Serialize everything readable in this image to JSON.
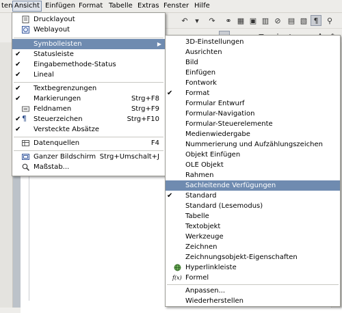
{
  "menubar": {
    "items": [
      "ten",
      "Ansicht",
      "Einfügen",
      "Format",
      "Tabelle",
      "Extras",
      "Fenster",
      "Hilfe"
    ]
  },
  "view_menu": {
    "items": [
      {
        "label": "Drucklayout",
        "checked": false,
        "icon": "print-layout-icon"
      },
      {
        "label": "Weblayout",
        "checked": true,
        "icon": "web-layout-icon"
      },
      {
        "label": "Symbolleisten",
        "submenu": true
      },
      {
        "label": "Statusleiste",
        "checked": true
      },
      {
        "label": "Eingabemethode-Status",
        "checked": true
      },
      {
        "label": "Lineal",
        "checked": true
      },
      {
        "label": "Textbegrenzungen",
        "checked": true
      },
      {
        "label": "Markierungen",
        "shortcut": "Strg+F8",
        "checked": true
      },
      {
        "label": "Feldnamen",
        "shortcut": "Strg+F9",
        "icon": "field-names-icon"
      },
      {
        "label": "Steuerzeichen",
        "shortcut": "Strg+F10",
        "icon": "pilcrow-icon"
      },
      {
        "label": "Versteckte Absätze",
        "checked": true
      },
      {
        "label": "Datenquellen",
        "shortcut": "F4",
        "icon": "data-sources-icon"
      },
      {
        "label": "Ganzer Bildschirm",
        "shortcut": "Strg+Umschalt+J",
        "icon": "full-screen-icon"
      },
      {
        "label": "Maßstab...",
        "icon": "zoom-icon"
      }
    ]
  },
  "toolbars_submenu": {
    "items": [
      {
        "label": "3D-Einstellungen"
      },
      {
        "label": "Ausrichten"
      },
      {
        "label": "Bild"
      },
      {
        "label": "Einfügen"
      },
      {
        "label": "Fontwork"
      },
      {
        "label": "Format",
        "checked": true
      },
      {
        "label": "Formular Entwurf"
      },
      {
        "label": "Formular-Navigation"
      },
      {
        "label": "Formular-Steuerelemente"
      },
      {
        "label": "Medienwiedergabe"
      },
      {
        "label": "Nummerierung und Aufzählungszeichen"
      },
      {
        "label": "Objekt Einfügen"
      },
      {
        "label": "OLE Objekt"
      },
      {
        "label": "Rahmen"
      },
      {
        "label": "Sachleitende Verfügungen",
        "highlighted": true
      },
      {
        "label": "Standard",
        "checked": true
      },
      {
        "label": "Standard (Lesemodus)"
      },
      {
        "label": "Tabelle"
      },
      {
        "label": "Textobjekt"
      },
      {
        "label": "Werkzeuge"
      },
      {
        "label": "Zeichnen"
      },
      {
        "label": "Zeichnungsobjekt-Eigenschaften"
      },
      {
        "label": "Hyperlinkleiste",
        "icon": "hyperlink-bar-icon"
      },
      {
        "label": "Formel",
        "icon": "formula-fx-icon",
        "icon_text": "f(x)"
      },
      {
        "label": "Anpassen..."
      },
      {
        "label": "Wiederherstellen"
      }
    ]
  },
  "colors": {
    "highlight": "#6f8bb0",
    "menu_bg": "#ffffff",
    "chrome_bg": "#edece9",
    "doc_bg": "#bcc2c9"
  }
}
